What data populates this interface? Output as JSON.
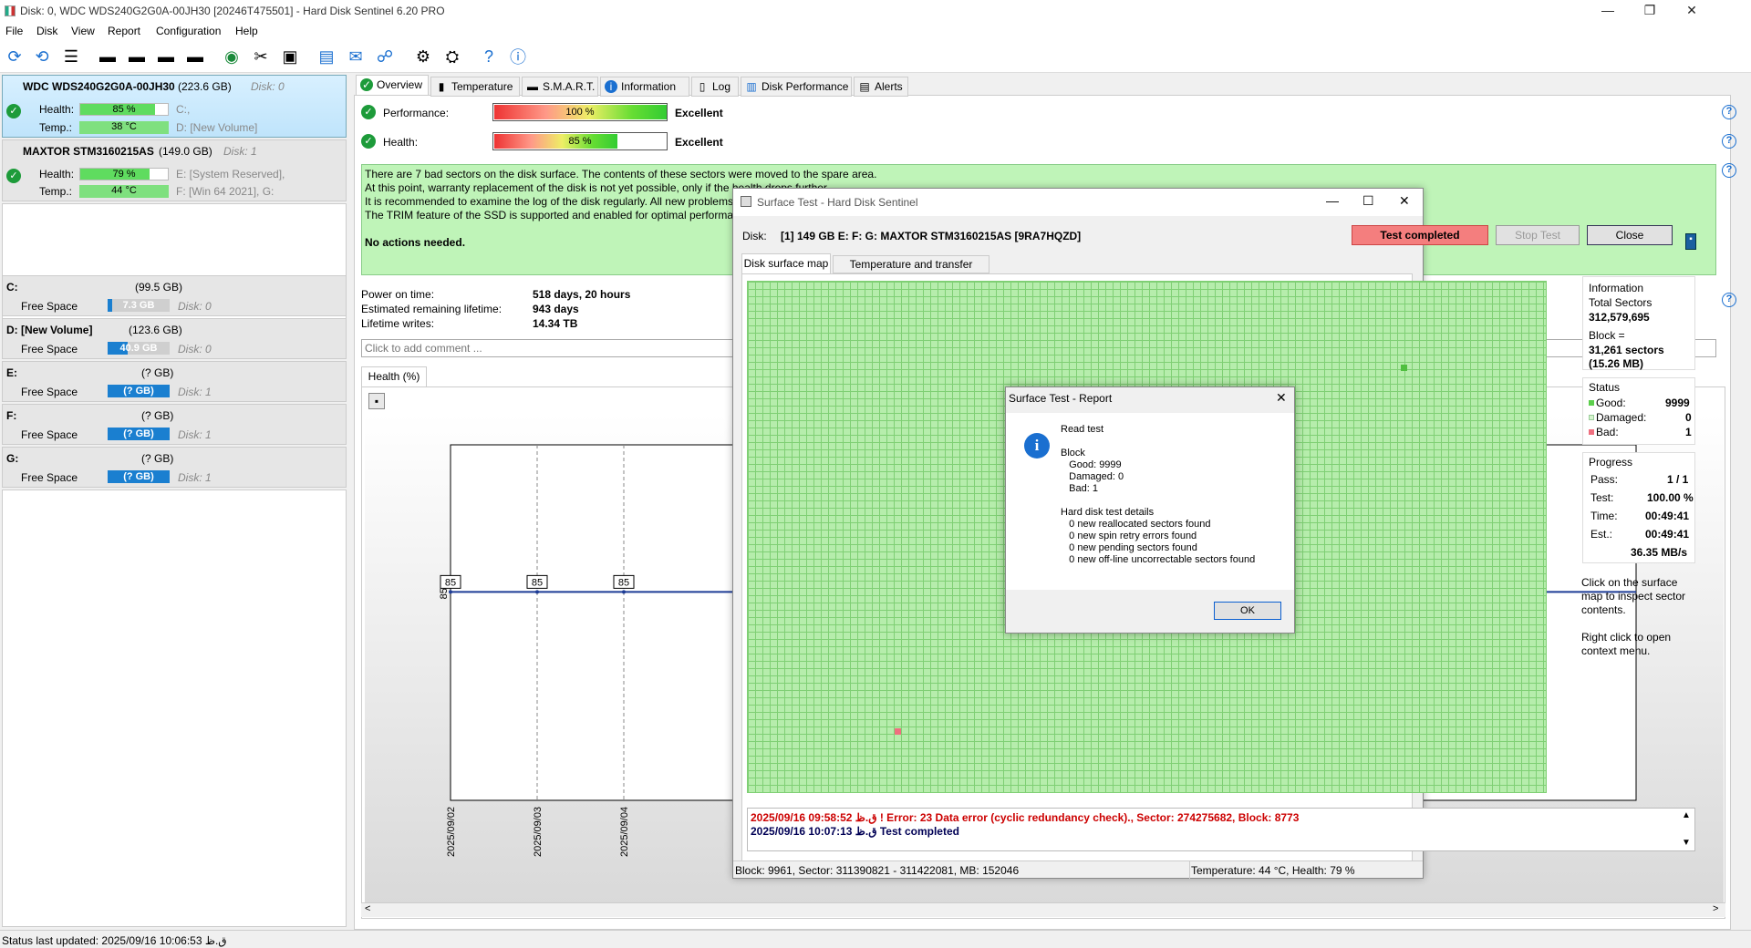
{
  "window": {
    "title": "Disk: 0, WDC WDS240G2G0A-00JH30 [20246T475501]  -  Hard Disk Sentinel 6.20 PRO",
    "min": "—",
    "max": "❐",
    "close": "✕"
  },
  "menu": [
    "File",
    "Disk",
    "View",
    "Report",
    "Configuration",
    "Help"
  ],
  "disks": [
    {
      "name": "WDC WDS240G2G0A-00JH30",
      "size": "(223.6 GB)",
      "disk": "Disk: 0",
      "health_label": "Health:",
      "health": "85 %",
      "health_value": 85,
      "temp_label": "Temp.:",
      "temp": "38 °C",
      "vol1": "C:,",
      "vol2": "D: [New Volume]"
    },
    {
      "name": "MAXTOR STM3160215AS",
      "size": "(149.0 GB)",
      "disk": "Disk: 1",
      "health_label": "Health:",
      "health": "79 %",
      "health_value": 79,
      "temp_label": "Temp.:",
      "temp": "44 °C",
      "vol1": "E: [System Reserved],",
      "vol2": "F: [Win 64 2021], G:"
    }
  ],
  "volumes": [
    {
      "name": "C:",
      "size": "(99.5 GB)",
      "label": "Free Space",
      "free": "7.3 GB",
      "fill": 0.07,
      "disk": "Disk: 0"
    },
    {
      "name": "D: [New Volume]",
      "size": "(123.6 GB)",
      "label": "Free Space",
      "free": "40.9 GB",
      "fill": 0.33,
      "disk": "Disk: 0"
    },
    {
      "name": "E:",
      "size": "(? GB)",
      "label": "Free Space",
      "free": "(? GB)",
      "fill": 1,
      "disk": "Disk: 1"
    },
    {
      "name": "F:",
      "size": "(? GB)",
      "label": "Free Space",
      "free": "(? GB)",
      "fill": 1,
      "disk": "Disk: 1"
    },
    {
      "name": "G:",
      "size": "(? GB)",
      "label": "Free Space",
      "free": "(? GB)",
      "fill": 1,
      "disk": "Disk: 1"
    }
  ],
  "tabs": [
    "Overview",
    "Temperature",
    "S.M.A.R.T.",
    "Information",
    "Log",
    "Disk Performance",
    "Alerts"
  ],
  "overview": {
    "performance_label": "Performance:",
    "performance": "100 %",
    "performance_value": 100,
    "performance_rating": "Excellent",
    "health_label": "Health:",
    "health": "85 %",
    "health_value": 85,
    "health_rating": "Excellent",
    "messages": [
      "There are 7 bad sectors on the disk surface. The contents of these sectors were moved to the spare area.",
      "At this point, warranty replacement of the disk is not yet possible, only if the health drops further.",
      "It is recommended to examine the log of the disk regularly. All new problems found will be logged there.",
      "The TRIM feature of the SSD is supported and enabled for optimal performance."
    ],
    "action": "No actions needed.",
    "power_on_label": "Power on time:",
    "power_on": "518 days, 20 hours",
    "lifetime_label": "Estimated remaining lifetime:",
    "lifetime": "943 days",
    "writes_label": "Lifetime writes:",
    "writes": "14.34 TB",
    "comment_placeholder": "Click to add comment ...",
    "health_tab": "Health (%)"
  },
  "chart_data": {
    "type": "line",
    "x": [
      "2025/09/02",
      "2025/09/03",
      "2025/09/04"
    ],
    "series": [
      {
        "values": [
          85,
          85,
          85
        ]
      }
    ],
    "ylabel": "85"
  },
  "surface": {
    "title": "Surface Test - Hard Disk Sentinel",
    "disk_label": "Disk:",
    "disk": "[1] 149 GB E: F: G: MAXTOR STM3160215AS [9RA7HQZD]",
    "status": "Test completed",
    "stop": "Stop Test",
    "close": "Close",
    "tab1": "Disk surface map",
    "tab2": "Temperature and transfer speed",
    "info_title": "Information",
    "total_label": "Total Sectors",
    "total": "312,579,695",
    "block_label": "Block =",
    "block": "31,261 sectors",
    "block_mb": "(15.26 MB)",
    "status_title": "Status",
    "good_label": "Good:",
    "good": "9999",
    "damaged_label": "Damaged:",
    "damaged": "0",
    "bad_label": "Bad:",
    "bad": "1",
    "progress_title": "Progress",
    "pass_label": "Pass:",
    "pass": "1 / 1",
    "test_label": "Test:",
    "test": "100.00 %",
    "time_label": "Time:",
    "time": "00:49:41",
    "est_label": "Est.:",
    "est": "00:49:41",
    "speed": "36.35 MB/s",
    "hint1": "Click on the surface map to inspect sector contents.",
    "hint2": "Right click to open context menu.",
    "log1": "2025/09/16  09:58:52 ق.ظ ! Error: 23 Data error (cyclic redundancy check)., Sector: 274275682, Block: 8773",
    "log2": "2025/09/16  10:07:13 ق.ظ   Test completed",
    "footer1": "Block: 9961, Sector: 311390821 - 311422081, MB: 152046",
    "footer2": "Temperature: 44  °C, Health: 79 %"
  },
  "report": {
    "title": "Surface Test - Report",
    "close": "✕",
    "lines": [
      "Read test",
      "",
      "Block",
      "   Good: 9999",
      "   Damaged: 0",
      "   Bad: 1",
      "",
      "Hard disk test details",
      "   0 new reallocated sectors found",
      "   0 new spin retry errors found",
      "   0 new pending sectors found",
      "   0 new off-line uncorrectable sectors found"
    ],
    "ok": "OK"
  },
  "statusbar": "Status last updated: 2025/09/16 10:06:53 ق.ظ"
}
